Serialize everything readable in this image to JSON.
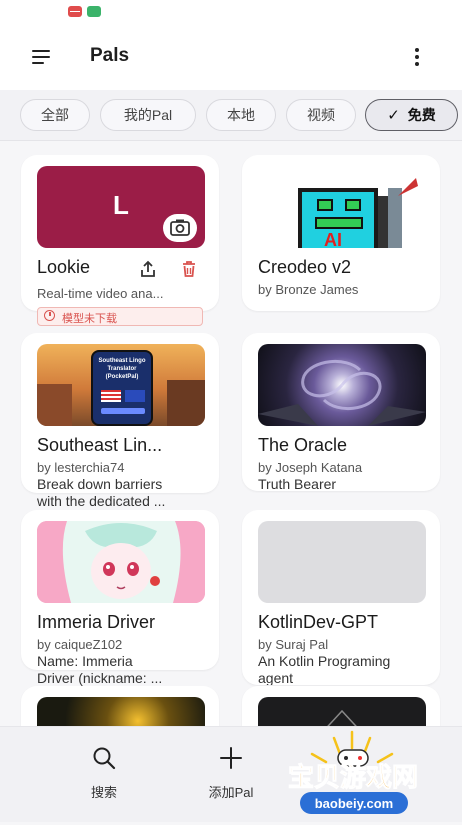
{
  "app": {
    "title": "Pals"
  },
  "filters": [
    {
      "label": "全部",
      "selected": false
    },
    {
      "label": "我的Pal",
      "selected": false
    },
    {
      "label": "本地",
      "selected": false
    },
    {
      "label": "视频",
      "selected": false
    },
    {
      "label": "免费",
      "selected": true
    }
  ],
  "pals": [
    {
      "name": "Lookie",
      "thumb_letter": "L",
      "line1": "Real-time video ana...",
      "warning": "模型未下载"
    },
    {
      "name": "Creodeo v2",
      "line1": "by Bronze James",
      "thumb_text": "AI"
    },
    {
      "name": "Southeast Lin...",
      "line1": "by lesterchia74",
      "line2": "Break down barriers",
      "line3": "with the dedicated ...",
      "thumb_caption": "Southeast Lingo Translator (PocketPal)"
    },
    {
      "name": "The Oracle",
      "line1": "by Joseph Katana",
      "line2": "Truth Bearer"
    },
    {
      "name": "Immeria Driver",
      "line1": "by caiqueZ102",
      "line2": "Name: Immeria",
      "line3": "Driver (nickname: ..."
    },
    {
      "name": "KotlinDev-GPT",
      "line1": "by Suraj Pal",
      "line2": "An Kotlin Programing",
      "line3": "agent"
    }
  ],
  "nav": {
    "search_label": "搜索",
    "add_label": "添加Pal"
  },
  "watermark": {
    "title": "宝贝游戏网",
    "url": "baobeiy.com"
  },
  "colors": {
    "lookie_thumb": "#9b1d47",
    "warning": "#d9534f"
  }
}
